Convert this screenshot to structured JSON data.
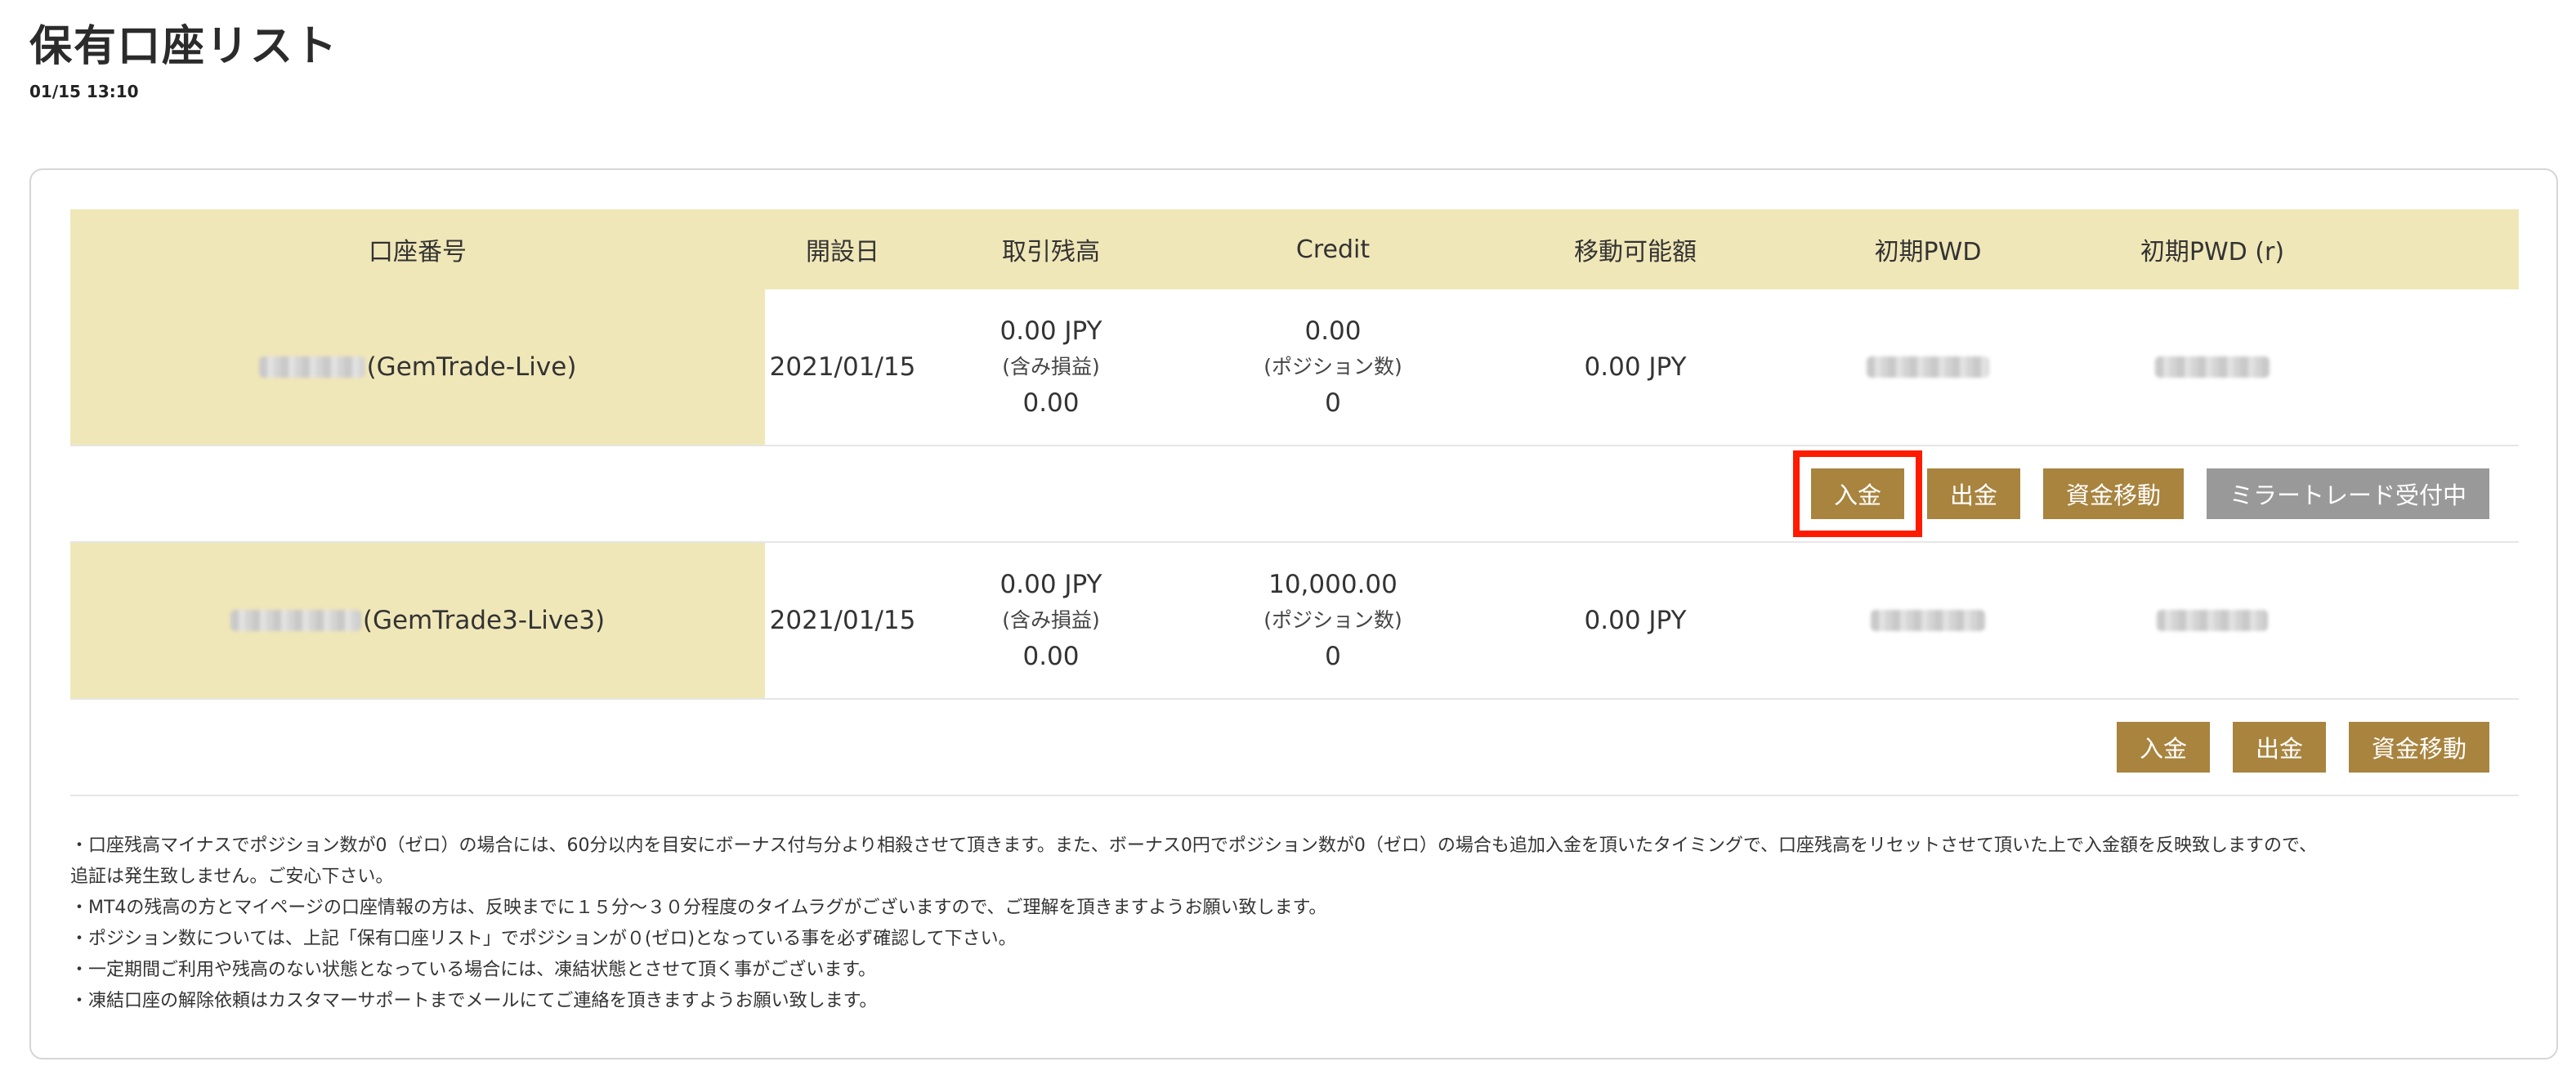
{
  "page": {
    "title": "保有口座リスト",
    "timestamp": "01/15 13:10"
  },
  "table": {
    "headers": [
      "口座番号",
      "開設日",
      "取引残高",
      "Credit",
      "移動可能額",
      "初期PWD",
      "初期PWD (r)"
    ],
    "rows": [
      {
        "account_suffix": "(GemTrade-Live)",
        "open_date": "2021/01/15",
        "balance": "0.00 JPY",
        "balance_note": "(含み損益)",
        "balance_pl": "0.00",
        "credit": "0.00",
        "credit_note": "(ポジション数)",
        "positions": "0",
        "movable": "0.00 JPY"
      },
      {
        "account_suffix": "(GemTrade3-Live3)",
        "open_date": "2021/01/15",
        "balance": "0.00 JPY",
        "balance_note": "(含み損益)",
        "balance_pl": "0.00",
        "credit": "10,000.00",
        "credit_note": "(ポジション数)",
        "positions": "0",
        "movable": "0.00 JPY"
      }
    ],
    "actions_row1": [
      "入金",
      "出金",
      "資金移動",
      "ミラートレード受付中"
    ],
    "actions_row2": [
      "入金",
      "出金",
      "資金移動"
    ]
  },
  "notes": [
    "・口座残高マイナスでポジション数が0（ゼロ）の場合には、60分以内を目安にボーナス付与分より相殺させて頂きます。また、ボーナス0円でポジション数が0（ゼロ）の場合も追加入金を頂いたタイミングで、口座残高をリセットさせて頂いた上で入金額を反映致しますので、",
    "追証は発生致しません。ご安心下さい。",
    "・MT4の残高の方とマイページの口座情報の方は、反映までに１５分〜３０分程度のタイムラグがございますので、ご理解を頂きますようお願い致します。",
    "・ポジション数については、上記「保有口座リスト」でポジションが０(ゼロ)となっている事を必ず確認して下さい。",
    "・一定期間ご利用や残高のない状態となっている場合には、凍結状態とさせて頂く事がございます。",
    "・凍結口座の解除依頼はカスタマーサポートまでメールにてご連絡を頂きますようお願い致します。"
  ],
  "colors": {
    "header_bg": "#f0e7b8",
    "button_gold": "#a8843f",
    "button_gray": "#999999",
    "highlight_red": "#ff1a00"
  }
}
